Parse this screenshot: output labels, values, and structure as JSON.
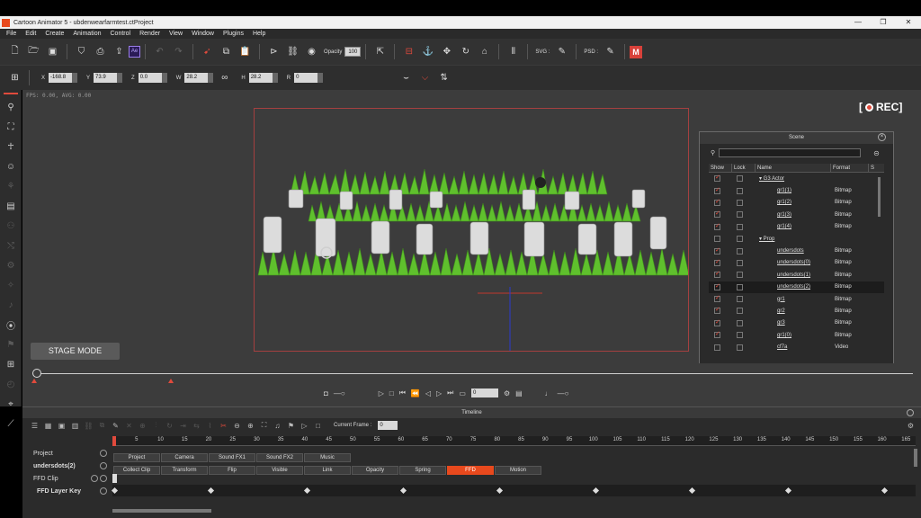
{
  "window": {
    "title": "Cartoon Animator 5 - ubdenwearfarmtest.ctProject",
    "controls": [
      "—",
      "❐",
      "✕"
    ]
  },
  "menu": [
    "File",
    "Edit",
    "Create",
    "Animation",
    "Control",
    "Render",
    "View",
    "Window",
    "Plugins",
    "Help"
  ],
  "toolbar": {
    "opacity_label": "Opacity",
    "opacity_value": "100",
    "svg_label": "SVG :",
    "psd_label": "PSD :",
    "ae_label": "Ae"
  },
  "transform": {
    "x_label": "X",
    "x_value": "-168.8",
    "y_label": "Y",
    "y_value": "73.9",
    "z_label": "Z",
    "z_value": "0.0",
    "w_label": "W",
    "w_value": "28.2",
    "h_label": "H",
    "h_value": "28.2",
    "r_label": "R",
    "r_value": "0"
  },
  "stage": {
    "fps_text": "FPS: 0.00, AVG: 0.00",
    "rec_label": "REC",
    "mode_button": "STAGE MODE"
  },
  "scene": {
    "title": "Scene",
    "columns": [
      "Show",
      "Lock",
      "Name",
      "Format",
      "S"
    ],
    "rows": [
      {
        "name": "G3 Actor",
        "format": "",
        "show": true,
        "group": true
      },
      {
        "name": "gr1(1)",
        "format": "Bitmap",
        "show": true
      },
      {
        "name": "gr1(2)",
        "format": "Bitmap",
        "show": true
      },
      {
        "name": "gr1(3)",
        "format": "Bitmap",
        "show": true
      },
      {
        "name": "gr1(4)",
        "format": "Bitmap",
        "show": true
      },
      {
        "name": "Prop",
        "format": "",
        "show": false,
        "group": true
      },
      {
        "name": "undersdots",
        "format": "Bitmap",
        "show": true
      },
      {
        "name": "undersdots(0)",
        "format": "Bitmap",
        "show": true
      },
      {
        "name": "undersdots(1)",
        "format": "Bitmap",
        "show": true
      },
      {
        "name": "undersdots(2)",
        "format": "Bitmap",
        "show": true,
        "selected": true
      },
      {
        "name": "gr1",
        "format": "Bitmap",
        "show": true
      },
      {
        "name": "gr2",
        "format": "Bitmap",
        "show": true
      },
      {
        "name": "gr3",
        "format": "Bitmap",
        "show": true
      },
      {
        "name": "gr1(0)",
        "format": "Bitmap",
        "show": true
      },
      {
        "name": "cf7a",
        "format": "Video",
        "show": false
      }
    ]
  },
  "playback": {
    "current_frame": "0"
  },
  "timeline": {
    "title": "Timeline",
    "current_frame_label": "Current Frame :",
    "current_frame_value": "0",
    "ruler_ticks": [
      "5",
      "10",
      "15",
      "20",
      "25",
      "30",
      "35",
      "40",
      "45",
      "50",
      "55",
      "60",
      "65",
      "70",
      "75",
      "80",
      "85",
      "90",
      "95",
      "100",
      "105",
      "110",
      "115",
      "120",
      "125",
      "130",
      "135",
      "140",
      "145",
      "150",
      "155",
      "160",
      "165"
    ],
    "tracks": [
      {
        "label": "Project",
        "bold": false
      },
      {
        "label": "undersdots(2)",
        "bold": true
      },
      {
        "label": "FFD Clip",
        "bold": false
      },
      {
        "label": "FFD Layer Key",
        "bold": true
      }
    ],
    "project_chips": [
      "Project",
      "Camera",
      "Sound FX1",
      "Sound FX2",
      "Music"
    ],
    "object_chips": [
      "Collect Clip",
      "Transform",
      "Flip",
      "Visible",
      "Link",
      "Opacity",
      "Spring",
      "FFD",
      "Motion"
    ],
    "active_chip": "FFD",
    "key_frames": [
      0,
      20,
      40,
      60,
      80,
      100,
      120,
      140,
      160
    ]
  },
  "colors": {
    "accent": "#e8491d",
    "stage_bg": "#3c3c3c",
    "panel_bg": "#2b2b2b",
    "grass": "#5fc02d"
  }
}
